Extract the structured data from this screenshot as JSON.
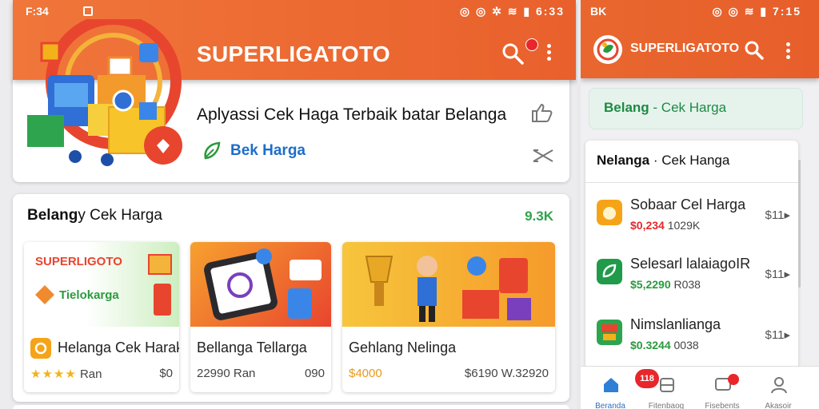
{
  "left_phone": {
    "status": {
      "time": "F:34",
      "right": "◎ ◎ ✲ ≋ ▮ 6:33"
    },
    "app_title": "SUPERLIGATOTO",
    "hero": {
      "title": "Aplyassi Cek Haga Terbaik batar Belanga",
      "link_label": "Bek Harga"
    },
    "section": {
      "title_bold": "Belang",
      "title_rest": "y Cek Harga",
      "count": "9.3K",
      "products": [
        {
          "name": "Helanga Cek Harak",
          "stars": "★★★★",
          "meta": "Ran",
          "price": "$0",
          "banner_title": "SUPERLIGOTO",
          "banner_sub": "Tielokarga"
        },
        {
          "name": "Bellanga Tellarga",
          "meta": "22990 Ran",
          "price": "090"
        },
        {
          "name": "Gehlang Nelinga",
          "meta": "$4000",
          "price": "$6190 W.32920"
        }
      ]
    },
    "colors": {
      "appbar": "#e9602c",
      "link": "#1e6ec8",
      "count": "#2fa34a"
    }
  },
  "right_phone": {
    "status": {
      "left": "BK",
      "right": "◎ ◎ ≋ ▮ 7:15"
    },
    "app_title": "SUPERLIGATOTO",
    "pill": {
      "bold": "Belang",
      "rest": " - Cek Harga"
    },
    "list": {
      "title_bold": "Nelanga",
      "title_rest": "· Cek Hanga",
      "items": [
        {
          "name": "Sobaar Cel Harga",
          "price_red": "$0,234",
          "price_grey": " 1029K",
          "rating": "$11▸"
        },
        {
          "name": "Selesarl lalaiagoIR",
          "price_red": "$5,2290",
          "price_grey": " R038",
          "rating": "$11▸"
        },
        {
          "name": "Nimslanlianga",
          "price_red": "$0.3244",
          "price_grey": " 0038",
          "rating": "$11▸"
        }
      ]
    },
    "nav": {
      "badge": "118",
      "tabs": [
        "Beranda",
        "Fitenbaog",
        "Fisebents",
        "Akasoir"
      ]
    }
  }
}
